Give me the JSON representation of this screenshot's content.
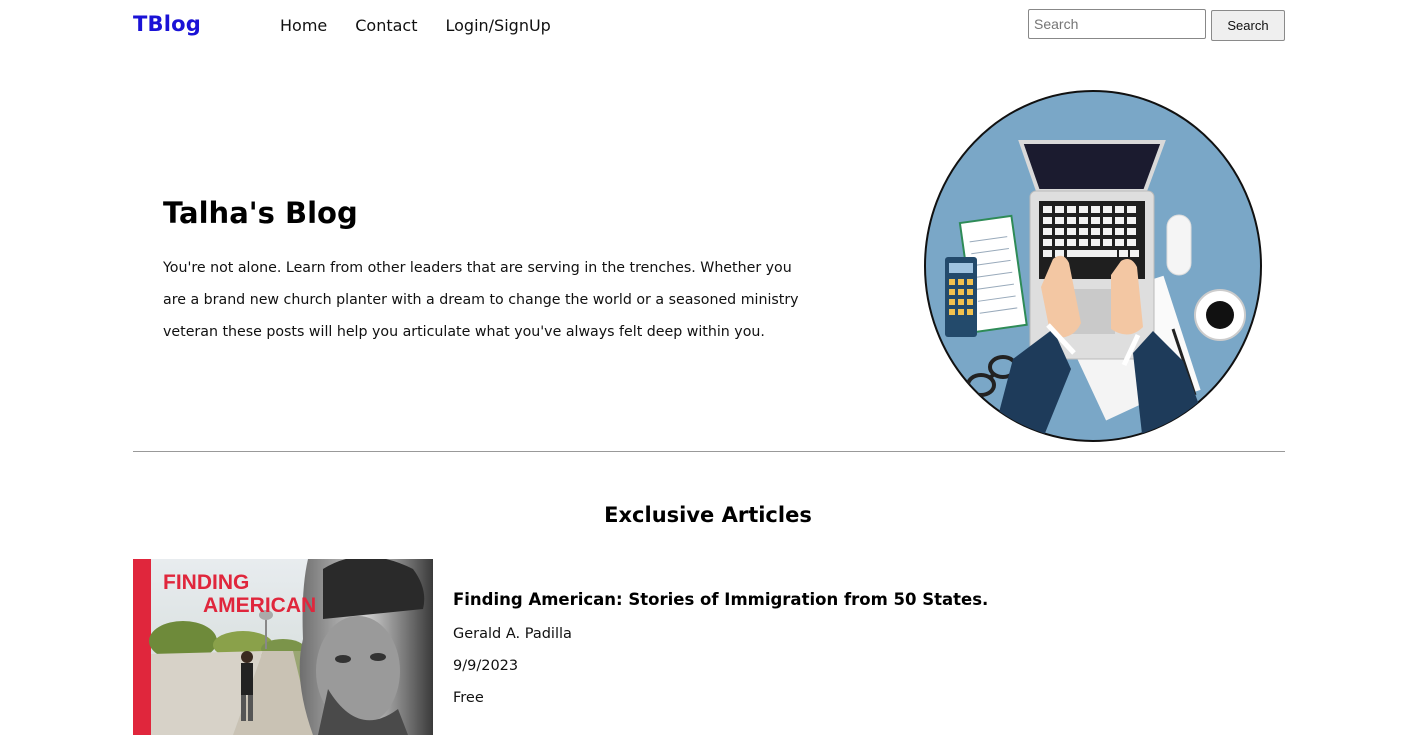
{
  "nav": {
    "brand": "TBlog",
    "links": [
      "Home",
      "Contact",
      "Login/SignUp"
    ],
    "search_placeholder": "Search",
    "search_button": "Search"
  },
  "hero": {
    "title": "Talha's Blog",
    "text": "You're not alone. Learn from other leaders that are serving in the trenches. Whether you are a brand new church planter with a dream to change the world or a seasoned ministry veteran these posts will help you articulate what you've always felt deep within you."
  },
  "articles_section": {
    "title": "Exclusive Articles",
    "items": [
      {
        "cover_text_line1": "FINDING",
        "cover_text_line2": "AMERICAN",
        "title": "Finding American: Stories of Immigration from 50 States.",
        "author": "Gerald A. Padilla",
        "date": "9/9/2023",
        "price": "Free"
      }
    ]
  },
  "colors": {
    "brand": "#1a12d6",
    "hero_circle_bg": "#7aa7c7",
    "cover_accent": "#e0263c"
  }
}
